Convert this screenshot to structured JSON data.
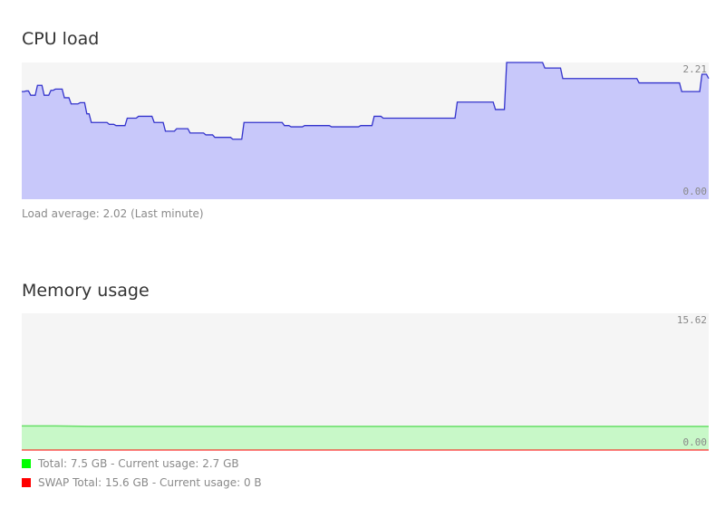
{
  "cpu": {
    "title": "CPU load",
    "caption": "Load average: 2.02 (Last minute)",
    "axis_max_label": "2.21",
    "axis_min_label": "0.00"
  },
  "memory": {
    "title": "Memory usage",
    "axis_max_label": "15.62",
    "axis_min_label": "0.00",
    "legend": [
      {
        "label": "Total: 7.5 GB - Current usage: 2.7 GB",
        "color": "#00ff00"
      },
      {
        "label": "SWAP Total: 15.6 GB - Current usage: 0 B",
        "color": "#ff0000"
      }
    ]
  },
  "colors": {
    "cpu_line": "#3333cc",
    "cpu_fill": "#c8c8fa",
    "mem_line": "#66e066",
    "mem_fill": "#c8f8c8"
  },
  "chart_data": [
    {
      "type": "area",
      "title": "CPU load",
      "ylim": [
        0,
        2.21
      ],
      "grid": false,
      "values": [
        1.74,
        1.74,
        1.75,
        1.75,
        1.68,
        1.68,
        1.68,
        1.84,
        1.84,
        1.84,
        1.68,
        1.68,
        1.68,
        1.76,
        1.76,
        1.78,
        1.78,
        1.78,
        1.78,
        1.64,
        1.64,
        1.64,
        1.54,
        1.54,
        1.54,
        1.54,
        1.56,
        1.56,
        1.56,
        1.38,
        1.38,
        1.24,
        1.24,
        1.24,
        1.24,
        1.24,
        1.24,
        1.24,
        1.24,
        1.21,
        1.21,
        1.21,
        1.19,
        1.19,
        1.19,
        1.19,
        1.19,
        1.31,
        1.31,
        1.31,
        1.31,
        1.31,
        1.34,
        1.34,
        1.34,
        1.34,
        1.34,
        1.34,
        1.34,
        1.24,
        1.24,
        1.24,
        1.24,
        1.24,
        1.1,
        1.1,
        1.1,
        1.1,
        1.1,
        1.14,
        1.14,
        1.14,
        1.14,
        1.14,
        1.14,
        1.07,
        1.07,
        1.07,
        1.07,
        1.07,
        1.07,
        1.07,
        1.04,
        1.04,
        1.04,
        1.04,
        1.0,
        1.0,
        1.0,
        1.0,
        1.0,
        1.0,
        1.0,
        1.0,
        0.97,
        0.97,
        0.97,
        0.97,
        0.97,
        1.24,
        1.24,
        1.24,
        1.24,
        1.24,
        1.24,
        1.24,
        1.24,
        1.24,
        1.24,
        1.24,
        1.24,
        1.24,
        1.24,
        1.24,
        1.24,
        1.24,
        1.24,
        1.19,
        1.19,
        1.19,
        1.17,
        1.17,
        1.17,
        1.17,
        1.17,
        1.17,
        1.19,
        1.19,
        1.19,
        1.19,
        1.19,
        1.19,
        1.19,
        1.19,
        1.19,
        1.19,
        1.19,
        1.19,
        1.17,
        1.17,
        1.17,
        1.17,
        1.17,
        1.17,
        1.17,
        1.17,
        1.17,
        1.17,
        1.17,
        1.17,
        1.17,
        1.19,
        1.19,
        1.19,
        1.19,
        1.19,
        1.19,
        1.34,
        1.34,
        1.34,
        1.34,
        1.31,
        1.31,
        1.31,
        1.31,
        1.31,
        1.31,
        1.31,
        1.31,
        1.31,
        1.31,
        1.31,
        1.31,
        1.31,
        1.31,
        1.31,
        1.31,
        1.31,
        1.31,
        1.31,
        1.31,
        1.31,
        1.31,
        1.31,
        1.31,
        1.31,
        1.31,
        1.31,
        1.31,
        1.31,
        1.31,
        1.31,
        1.31,
        1.31,
        1.57,
        1.57,
        1.57,
        1.57,
        1.57,
        1.57,
        1.57,
        1.57,
        1.57,
        1.57,
        1.57,
        1.57,
        1.57,
        1.57,
        1.57,
        1.57,
        1.57,
        1.45,
        1.45,
        1.45,
        1.45,
        1.45,
        2.21,
        2.21,
        2.21,
        2.21,
        2.21,
        2.21,
        2.21,
        2.21,
        2.21,
        2.21,
        2.21,
        2.21,
        2.21,
        2.21,
        2.21,
        2.21,
        2.21,
        2.12,
        2.12,
        2.12,
        2.12,
        2.12,
        2.12,
        2.12,
        2.12,
        1.95,
        1.95,
        1.95,
        1.95,
        1.95,
        1.95,
        1.95,
        1.95,
        1.95,
        1.95,
        1.95,
        1.95,
        1.95,
        1.95,
        1.95,
        1.95,
        1.95,
        1.95,
        1.95,
        1.95,
        1.95,
        1.95,
        1.95,
        1.95,
        1.95,
        1.95,
        1.95,
        1.95,
        1.95,
        1.95,
        1.95,
        1.95,
        1.95,
        1.95,
        1.88,
        1.88,
        1.88,
        1.88,
        1.88,
        1.88,
        1.88,
        1.88,
        1.88,
        1.88,
        1.88,
        1.88,
        1.88,
        1.88,
        1.88,
        1.88,
        1.88,
        1.88,
        1.88,
        1.74,
        1.74,
        1.74,
        1.74,
        1.74,
        1.74,
        1.74,
        1.74,
        1.74,
        2.02,
        2.02,
        2.02,
        1.95
      ]
    },
    {
      "type": "area",
      "title": "Memory usage",
      "ylim": [
        0,
        15.62
      ],
      "grid": false,
      "series": [
        {
          "name": "Total: 7.5 GB - Current usage: 2.7 GB",
          "values": [
            2.75,
            2.75,
            2.7,
            2.7,
            2.7,
            2.7,
            2.7,
            2.7,
            2.7,
            2.7,
            2.7,
            2.7,
            2.7,
            2.7,
            2.7,
            2.7,
            2.7,
            2.7,
            2.7,
            2.7,
            2.7
          ]
        },
        {
          "name": "SWAP Total: 15.6 GB - Current usage: 0 B",
          "values": [
            0,
            0,
            0,
            0,
            0,
            0,
            0,
            0,
            0,
            0,
            0,
            0,
            0,
            0,
            0,
            0,
            0,
            0,
            0,
            0,
            0
          ]
        }
      ]
    }
  ]
}
